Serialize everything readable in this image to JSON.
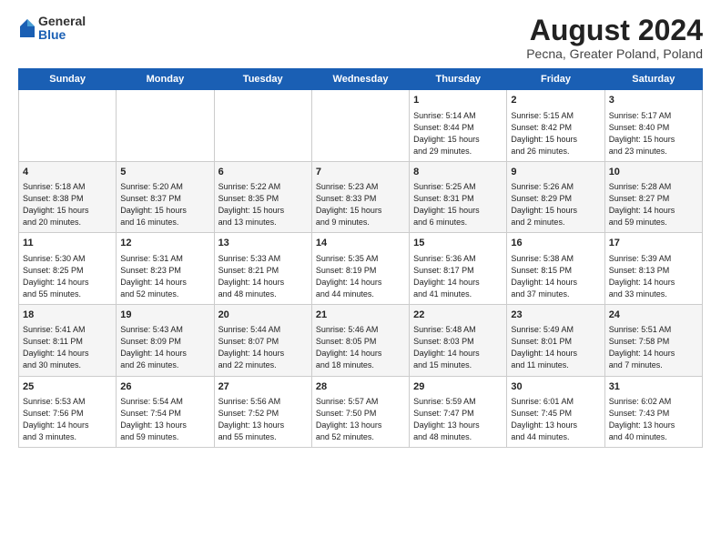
{
  "header": {
    "logo_general": "General",
    "logo_blue": "Blue",
    "title": "August 2024",
    "subtitle": "Pecna, Greater Poland, Poland"
  },
  "days_of_week": [
    "Sunday",
    "Monday",
    "Tuesday",
    "Wednesday",
    "Thursday",
    "Friday",
    "Saturday"
  ],
  "weeks": [
    [
      {
        "day": "",
        "content": ""
      },
      {
        "day": "",
        "content": ""
      },
      {
        "day": "",
        "content": ""
      },
      {
        "day": "",
        "content": ""
      },
      {
        "day": "1",
        "content": "Sunrise: 5:14 AM\nSunset: 8:44 PM\nDaylight: 15 hours\nand 29 minutes."
      },
      {
        "day": "2",
        "content": "Sunrise: 5:15 AM\nSunset: 8:42 PM\nDaylight: 15 hours\nand 26 minutes."
      },
      {
        "day": "3",
        "content": "Sunrise: 5:17 AM\nSunset: 8:40 PM\nDaylight: 15 hours\nand 23 minutes."
      }
    ],
    [
      {
        "day": "4",
        "content": "Sunrise: 5:18 AM\nSunset: 8:38 PM\nDaylight: 15 hours\nand 20 minutes."
      },
      {
        "day": "5",
        "content": "Sunrise: 5:20 AM\nSunset: 8:37 PM\nDaylight: 15 hours\nand 16 minutes."
      },
      {
        "day": "6",
        "content": "Sunrise: 5:22 AM\nSunset: 8:35 PM\nDaylight: 15 hours\nand 13 minutes."
      },
      {
        "day": "7",
        "content": "Sunrise: 5:23 AM\nSunset: 8:33 PM\nDaylight: 15 hours\nand 9 minutes."
      },
      {
        "day": "8",
        "content": "Sunrise: 5:25 AM\nSunset: 8:31 PM\nDaylight: 15 hours\nand 6 minutes."
      },
      {
        "day": "9",
        "content": "Sunrise: 5:26 AM\nSunset: 8:29 PM\nDaylight: 15 hours\nand 2 minutes."
      },
      {
        "day": "10",
        "content": "Sunrise: 5:28 AM\nSunset: 8:27 PM\nDaylight: 14 hours\nand 59 minutes."
      }
    ],
    [
      {
        "day": "11",
        "content": "Sunrise: 5:30 AM\nSunset: 8:25 PM\nDaylight: 14 hours\nand 55 minutes."
      },
      {
        "day": "12",
        "content": "Sunrise: 5:31 AM\nSunset: 8:23 PM\nDaylight: 14 hours\nand 52 minutes."
      },
      {
        "day": "13",
        "content": "Sunrise: 5:33 AM\nSunset: 8:21 PM\nDaylight: 14 hours\nand 48 minutes."
      },
      {
        "day": "14",
        "content": "Sunrise: 5:35 AM\nSunset: 8:19 PM\nDaylight: 14 hours\nand 44 minutes."
      },
      {
        "day": "15",
        "content": "Sunrise: 5:36 AM\nSunset: 8:17 PM\nDaylight: 14 hours\nand 41 minutes."
      },
      {
        "day": "16",
        "content": "Sunrise: 5:38 AM\nSunset: 8:15 PM\nDaylight: 14 hours\nand 37 minutes."
      },
      {
        "day": "17",
        "content": "Sunrise: 5:39 AM\nSunset: 8:13 PM\nDaylight: 14 hours\nand 33 minutes."
      }
    ],
    [
      {
        "day": "18",
        "content": "Sunrise: 5:41 AM\nSunset: 8:11 PM\nDaylight: 14 hours\nand 30 minutes."
      },
      {
        "day": "19",
        "content": "Sunrise: 5:43 AM\nSunset: 8:09 PM\nDaylight: 14 hours\nand 26 minutes."
      },
      {
        "day": "20",
        "content": "Sunrise: 5:44 AM\nSunset: 8:07 PM\nDaylight: 14 hours\nand 22 minutes."
      },
      {
        "day": "21",
        "content": "Sunrise: 5:46 AM\nSunset: 8:05 PM\nDaylight: 14 hours\nand 18 minutes."
      },
      {
        "day": "22",
        "content": "Sunrise: 5:48 AM\nSunset: 8:03 PM\nDaylight: 14 hours\nand 15 minutes."
      },
      {
        "day": "23",
        "content": "Sunrise: 5:49 AM\nSunset: 8:01 PM\nDaylight: 14 hours\nand 11 minutes."
      },
      {
        "day": "24",
        "content": "Sunrise: 5:51 AM\nSunset: 7:58 PM\nDaylight: 14 hours\nand 7 minutes."
      }
    ],
    [
      {
        "day": "25",
        "content": "Sunrise: 5:53 AM\nSunset: 7:56 PM\nDaylight: 14 hours\nand 3 minutes."
      },
      {
        "day": "26",
        "content": "Sunrise: 5:54 AM\nSunset: 7:54 PM\nDaylight: 13 hours\nand 59 minutes."
      },
      {
        "day": "27",
        "content": "Sunrise: 5:56 AM\nSunset: 7:52 PM\nDaylight: 13 hours\nand 55 minutes."
      },
      {
        "day": "28",
        "content": "Sunrise: 5:57 AM\nSunset: 7:50 PM\nDaylight: 13 hours\nand 52 minutes."
      },
      {
        "day": "29",
        "content": "Sunrise: 5:59 AM\nSunset: 7:47 PM\nDaylight: 13 hours\nand 48 minutes."
      },
      {
        "day": "30",
        "content": "Sunrise: 6:01 AM\nSunset: 7:45 PM\nDaylight: 13 hours\nand 44 minutes."
      },
      {
        "day": "31",
        "content": "Sunrise: 6:02 AM\nSunset: 7:43 PM\nDaylight: 13 hours\nand 40 minutes."
      }
    ]
  ]
}
